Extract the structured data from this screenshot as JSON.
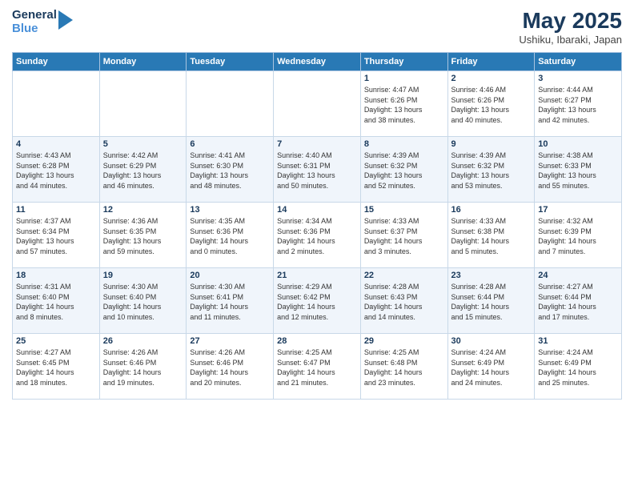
{
  "header": {
    "logo_line1": "General",
    "logo_line2": "Blue",
    "month_year": "May 2025",
    "location": "Ushiku, Ibaraki, Japan"
  },
  "weekdays": [
    "Sunday",
    "Monday",
    "Tuesday",
    "Wednesday",
    "Thursday",
    "Friday",
    "Saturday"
  ],
  "rows": [
    [
      {
        "day": "",
        "info": ""
      },
      {
        "day": "",
        "info": ""
      },
      {
        "day": "",
        "info": ""
      },
      {
        "day": "",
        "info": ""
      },
      {
        "day": "1",
        "info": "Sunrise: 4:47 AM\nSunset: 6:26 PM\nDaylight: 13 hours\nand 38 minutes."
      },
      {
        "day": "2",
        "info": "Sunrise: 4:46 AM\nSunset: 6:26 PM\nDaylight: 13 hours\nand 40 minutes."
      },
      {
        "day": "3",
        "info": "Sunrise: 4:44 AM\nSunset: 6:27 PM\nDaylight: 13 hours\nand 42 minutes."
      }
    ],
    [
      {
        "day": "4",
        "info": "Sunrise: 4:43 AM\nSunset: 6:28 PM\nDaylight: 13 hours\nand 44 minutes."
      },
      {
        "day": "5",
        "info": "Sunrise: 4:42 AM\nSunset: 6:29 PM\nDaylight: 13 hours\nand 46 minutes."
      },
      {
        "day": "6",
        "info": "Sunrise: 4:41 AM\nSunset: 6:30 PM\nDaylight: 13 hours\nand 48 minutes."
      },
      {
        "day": "7",
        "info": "Sunrise: 4:40 AM\nSunset: 6:31 PM\nDaylight: 13 hours\nand 50 minutes."
      },
      {
        "day": "8",
        "info": "Sunrise: 4:39 AM\nSunset: 6:32 PM\nDaylight: 13 hours\nand 52 minutes."
      },
      {
        "day": "9",
        "info": "Sunrise: 4:39 AM\nSunset: 6:32 PM\nDaylight: 13 hours\nand 53 minutes."
      },
      {
        "day": "10",
        "info": "Sunrise: 4:38 AM\nSunset: 6:33 PM\nDaylight: 13 hours\nand 55 minutes."
      }
    ],
    [
      {
        "day": "11",
        "info": "Sunrise: 4:37 AM\nSunset: 6:34 PM\nDaylight: 13 hours\nand 57 minutes."
      },
      {
        "day": "12",
        "info": "Sunrise: 4:36 AM\nSunset: 6:35 PM\nDaylight: 13 hours\nand 59 minutes."
      },
      {
        "day": "13",
        "info": "Sunrise: 4:35 AM\nSunset: 6:36 PM\nDaylight: 14 hours\nand 0 minutes."
      },
      {
        "day": "14",
        "info": "Sunrise: 4:34 AM\nSunset: 6:36 PM\nDaylight: 14 hours\nand 2 minutes."
      },
      {
        "day": "15",
        "info": "Sunrise: 4:33 AM\nSunset: 6:37 PM\nDaylight: 14 hours\nand 3 minutes."
      },
      {
        "day": "16",
        "info": "Sunrise: 4:33 AM\nSunset: 6:38 PM\nDaylight: 14 hours\nand 5 minutes."
      },
      {
        "day": "17",
        "info": "Sunrise: 4:32 AM\nSunset: 6:39 PM\nDaylight: 14 hours\nand 7 minutes."
      }
    ],
    [
      {
        "day": "18",
        "info": "Sunrise: 4:31 AM\nSunset: 6:40 PM\nDaylight: 14 hours\nand 8 minutes."
      },
      {
        "day": "19",
        "info": "Sunrise: 4:30 AM\nSunset: 6:40 PM\nDaylight: 14 hours\nand 10 minutes."
      },
      {
        "day": "20",
        "info": "Sunrise: 4:30 AM\nSunset: 6:41 PM\nDaylight: 14 hours\nand 11 minutes."
      },
      {
        "day": "21",
        "info": "Sunrise: 4:29 AM\nSunset: 6:42 PM\nDaylight: 14 hours\nand 12 minutes."
      },
      {
        "day": "22",
        "info": "Sunrise: 4:28 AM\nSunset: 6:43 PM\nDaylight: 14 hours\nand 14 minutes."
      },
      {
        "day": "23",
        "info": "Sunrise: 4:28 AM\nSunset: 6:44 PM\nDaylight: 14 hours\nand 15 minutes."
      },
      {
        "day": "24",
        "info": "Sunrise: 4:27 AM\nSunset: 6:44 PM\nDaylight: 14 hours\nand 17 minutes."
      }
    ],
    [
      {
        "day": "25",
        "info": "Sunrise: 4:27 AM\nSunset: 6:45 PM\nDaylight: 14 hours\nand 18 minutes."
      },
      {
        "day": "26",
        "info": "Sunrise: 4:26 AM\nSunset: 6:46 PM\nDaylight: 14 hours\nand 19 minutes."
      },
      {
        "day": "27",
        "info": "Sunrise: 4:26 AM\nSunset: 6:46 PM\nDaylight: 14 hours\nand 20 minutes."
      },
      {
        "day": "28",
        "info": "Sunrise: 4:25 AM\nSunset: 6:47 PM\nDaylight: 14 hours\nand 21 minutes."
      },
      {
        "day": "29",
        "info": "Sunrise: 4:25 AM\nSunset: 6:48 PM\nDaylight: 14 hours\nand 23 minutes."
      },
      {
        "day": "30",
        "info": "Sunrise: 4:24 AM\nSunset: 6:49 PM\nDaylight: 14 hours\nand 24 minutes."
      },
      {
        "day": "31",
        "info": "Sunrise: 4:24 AM\nSunset: 6:49 PM\nDaylight: 14 hours\nand 25 minutes."
      }
    ]
  ]
}
